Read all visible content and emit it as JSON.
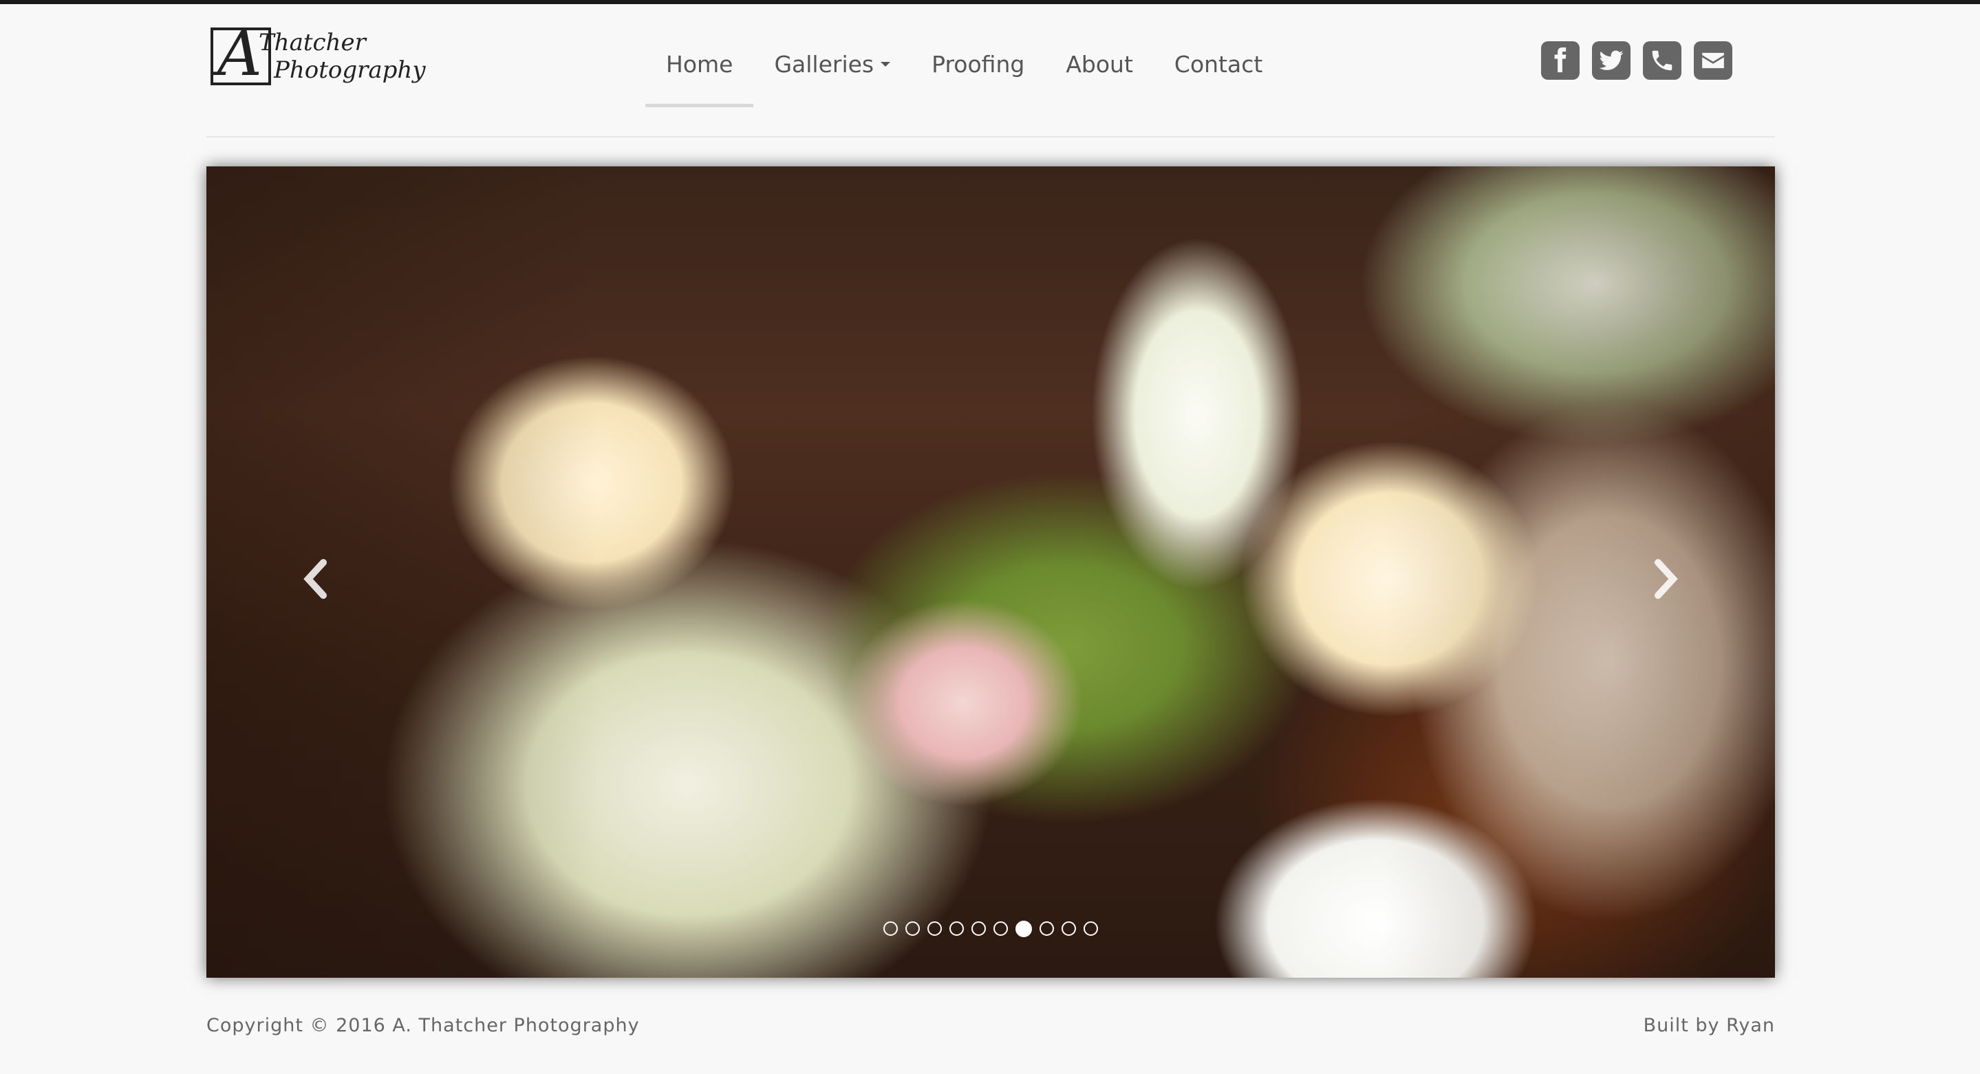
{
  "brand": {
    "logo_alt": "A. Thatcher Photography logo",
    "line1": "Thatcher",
    "line2": "Photography",
    "mark": "A"
  },
  "nav": {
    "items": [
      {
        "label": "Home",
        "active": true
      },
      {
        "label": "Galleries",
        "dropdown": true
      },
      {
        "label": "Proofing"
      },
      {
        "label": "About"
      },
      {
        "label": "Contact"
      }
    ]
  },
  "social": [
    {
      "name": "facebook-icon"
    },
    {
      "name": "twitter-icon"
    },
    {
      "name": "phone-icon"
    },
    {
      "name": "envelope-icon"
    }
  ],
  "carousel": {
    "image_desc": "Bridal bouquet of cream and pink roses, calla lilies and green hypericum berries",
    "slide_count": 10,
    "active_index": 6
  },
  "footer": {
    "copyright": "Copyright © 2016 A. Thatcher Photography",
    "credit": "Built by Ryan"
  },
  "colors": {
    "background": "#f8f8f8",
    "social_bg": "#666666",
    "nav_text": "#555555"
  }
}
